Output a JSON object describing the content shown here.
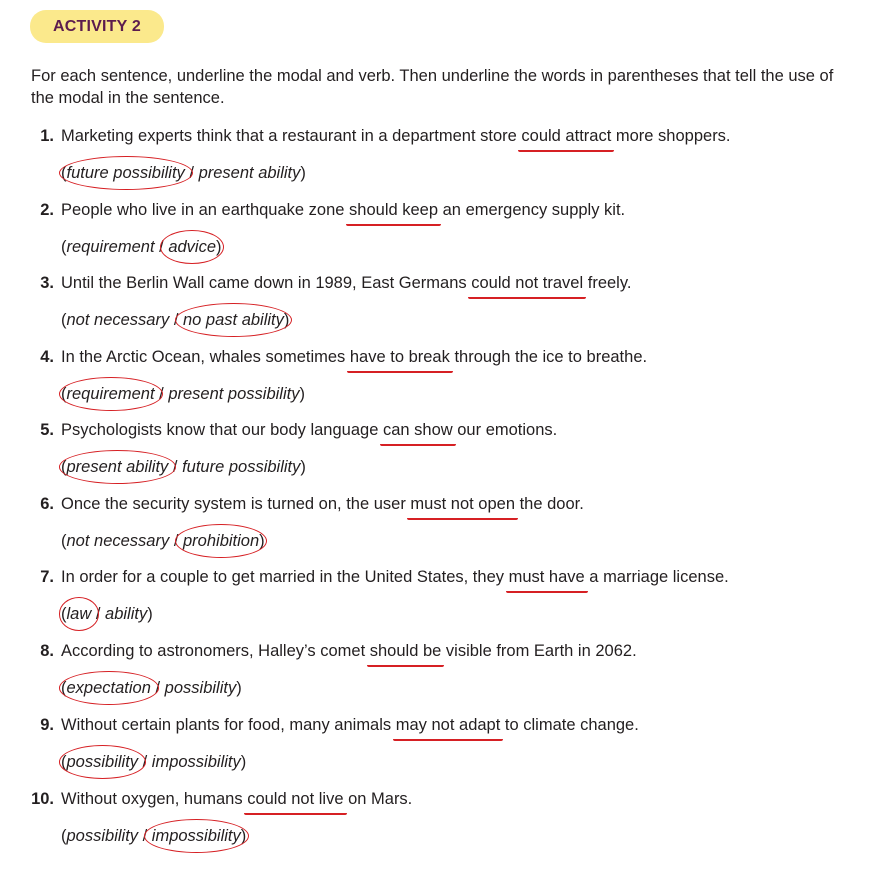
{
  "activity": {
    "label": "ACTIVITY 2"
  },
  "instructions": "For each sentence, underline the modal and verb. Then underline the words in parentheses that tell the use of the modal in the sentence.",
  "colors": {
    "badge_bg": "#fbe98c",
    "badge_text": "#5c1c4e",
    "annotation_red": "#d62024"
  },
  "items": [
    {
      "number": "1.",
      "before": "Marketing experts think that a restaurant in a department store ",
      "modal": "could attract",
      "after": " more shoppers.",
      "option1": "future possibility",
      "option2": "present ability",
      "circled": 1
    },
    {
      "number": "2.",
      "before": "People who live in an earthquake zone ",
      "modal": "should keep",
      "after": " an emergency supply kit.",
      "option1": "requirement",
      "option2": "advice",
      "circled": 2
    },
    {
      "number": "3.",
      "before": "Until the Berlin Wall came down in 1989, East Germans ",
      "modal": "could not travel",
      "after": " freely.",
      "option1": "not necessary",
      "option2": "no past ability",
      "circled": 2
    },
    {
      "number": "4.",
      "before": "In the Arctic Ocean, whales sometimes ",
      "modal": "have to break",
      "after": " through the ice to breathe.",
      "option1": "requirement",
      "option2": "present possibility",
      "circled": 1
    },
    {
      "number": "5.",
      "before": "Psychologists know that our body language ",
      "modal": "can show",
      "after": " our emotions.",
      "option1": "present ability",
      "option2": "future possibility",
      "circled": 1
    },
    {
      "number": "6.",
      "before": "Once the security system is turned on, the user ",
      "modal": "must not open",
      "after": " the door.",
      "option1": "not necessary",
      "option2": "prohibition",
      "circled": 2
    },
    {
      "number": "7.",
      "before": "In order for a couple to get married in the United States, they ",
      "modal": "must have",
      "after": " a marriage license.",
      "option1": "law",
      "option2": "ability",
      "circled": 1
    },
    {
      "number": "8.",
      "before": "According to astronomers, Halley’s comet ",
      "modal": "should be",
      "after": " visible from Earth in 2062.",
      "option1": "expectation",
      "option2": "possibility",
      "circled": 1
    },
    {
      "number": "9.",
      "before": "Without certain plants for food, many animals ",
      "modal": "may not adapt",
      "after": " to climate change.",
      "option1": "possibility",
      "option2": "impossibility",
      "circled": 1
    },
    {
      "number": "10.",
      "before": "Without oxygen, humans ",
      "modal": "could not live",
      "after": " on Mars.",
      "option1": "possibility",
      "option2": "impossibility",
      "circled": 2
    }
  ]
}
